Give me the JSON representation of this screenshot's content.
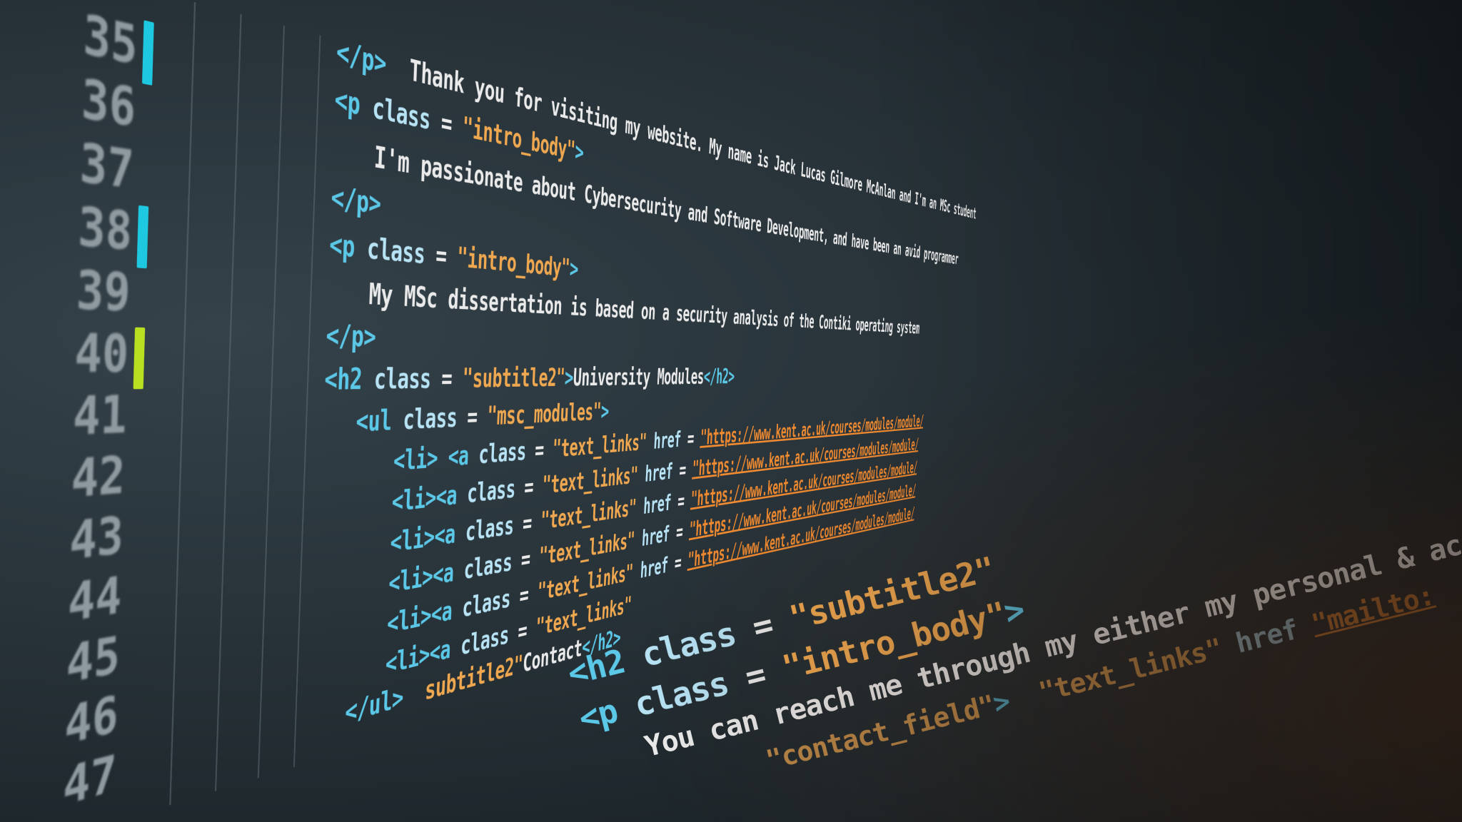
{
  "editor": {
    "line_numbers": [
      "35",
      "36",
      "37",
      "38",
      "39",
      "40",
      "41",
      "42",
      "43",
      "44",
      "45",
      "46",
      "47"
    ],
    "change_marks": [
      {
        "line": "35",
        "color": "#1ec8e0"
      },
      {
        "line": "38",
        "color": "#1ec8e0"
      },
      {
        "line": "40",
        "color": "#b8e020"
      }
    ],
    "lines": {
      "l34": {
        "close": "</p>",
        "text": "Thank you for visiting my website. My name is Jack Lucas Gilmore McAnlan and I'm an MSc student"
      },
      "l35": {
        "open": "<p",
        "attr": "class",
        "eq": "=",
        "val": "\"intro_body\"",
        "gt": ">"
      },
      "l36": {
        "text": "I'm passionate about Cybersecurity and Software Development, and have been an avid programmer"
      },
      "l37": {
        "close": "</p>"
      },
      "l38": {
        "open": "<p",
        "attr": "class",
        "eq": "=",
        "val": "\"intro_body\"",
        "gt": ">"
      },
      "l39": {
        "text": "My MSc dissertation is based on a security analysis of the Contiki operating system"
      },
      "l40": {
        "close": "</p>"
      },
      "l41": {
        "open": "<h2",
        "attr": "class",
        "eq": "=",
        "val": "\"subtitle2\"",
        "gt": ">",
        "text": "University Modules",
        "end": "</h2>"
      },
      "l42": {
        "open": "<ul",
        "attr": "class",
        "eq": "=",
        "val": "\"msc_modules\"",
        "gt": ">"
      },
      "l43": {
        "open": "<li> <a",
        "attr": "class",
        "eq": "=",
        "val": "\"text_links\"",
        "href": "href",
        "url": "\"https://www.kent.ac.uk/courses/modules/module/"
      },
      "l44": {
        "open": "<li><a",
        "attr": "class",
        "eq": "=",
        "val": "\"text_links\"",
        "href": "href",
        "url": "\"https://www.kent.ac.uk/courses/modules/module/"
      },
      "l45": {
        "open": "<li><a",
        "attr": "class",
        "eq": "=",
        "val": "\"text_links\"",
        "href": "href",
        "url": "\"https://www.kent.ac.uk/courses/modules/module/"
      },
      "l46": {
        "open": "<li><a",
        "attr": "class",
        "eq": "=",
        "val": "\"text_links\"",
        "href": "href",
        "url": "\"https://www.kent.ac.uk/courses/modules/module/"
      },
      "l47": {
        "open": "<li><a",
        "attr": "class",
        "eq": "=",
        "val": "\"text_links\"",
        "href": "href",
        "url": "\"https://www.kent.ac.uk/courses/modules/module/"
      },
      "l48": {
        "open": "<li><a",
        "attr": "class",
        "eq": "=",
        "val": "\"text_links\""
      },
      "l49": {
        "close": "</ul>",
        "open2": "subtitle2\"",
        "text": "Contact",
        "end": "</h2>"
      },
      "l50": {
        "open": "<h2",
        "attr": "class",
        "eq": "=",
        "val": "\"subtitle2\"",
        "text2": "Contact",
        "end": "</h2>"
      },
      "l51": {
        "open": "<p",
        "attr": "class",
        "eq": "=",
        "val": "\"intro_body\"",
        "gt": ">"
      },
      "l52": {
        "text": "You can reach me through my either my personal & academic email accounts:"
      },
      "l53": {
        "val": "\"contact_field\"",
        "gt": ">",
        "val2": "\"text_links\"",
        "href": "href",
        "url": "\"mailto:"
      },
      "l54": {
        "val": "_body\"",
        "gt": ">",
        "val2": "\"text_links\"",
        "href": "href",
        "url": "\"mailto:"
      }
    }
  },
  "colors": {
    "tag": "#5cc8e8",
    "string": "#f0a850",
    "url": "#f08a30",
    "text": "#eaeaea",
    "background": "#273238"
  }
}
